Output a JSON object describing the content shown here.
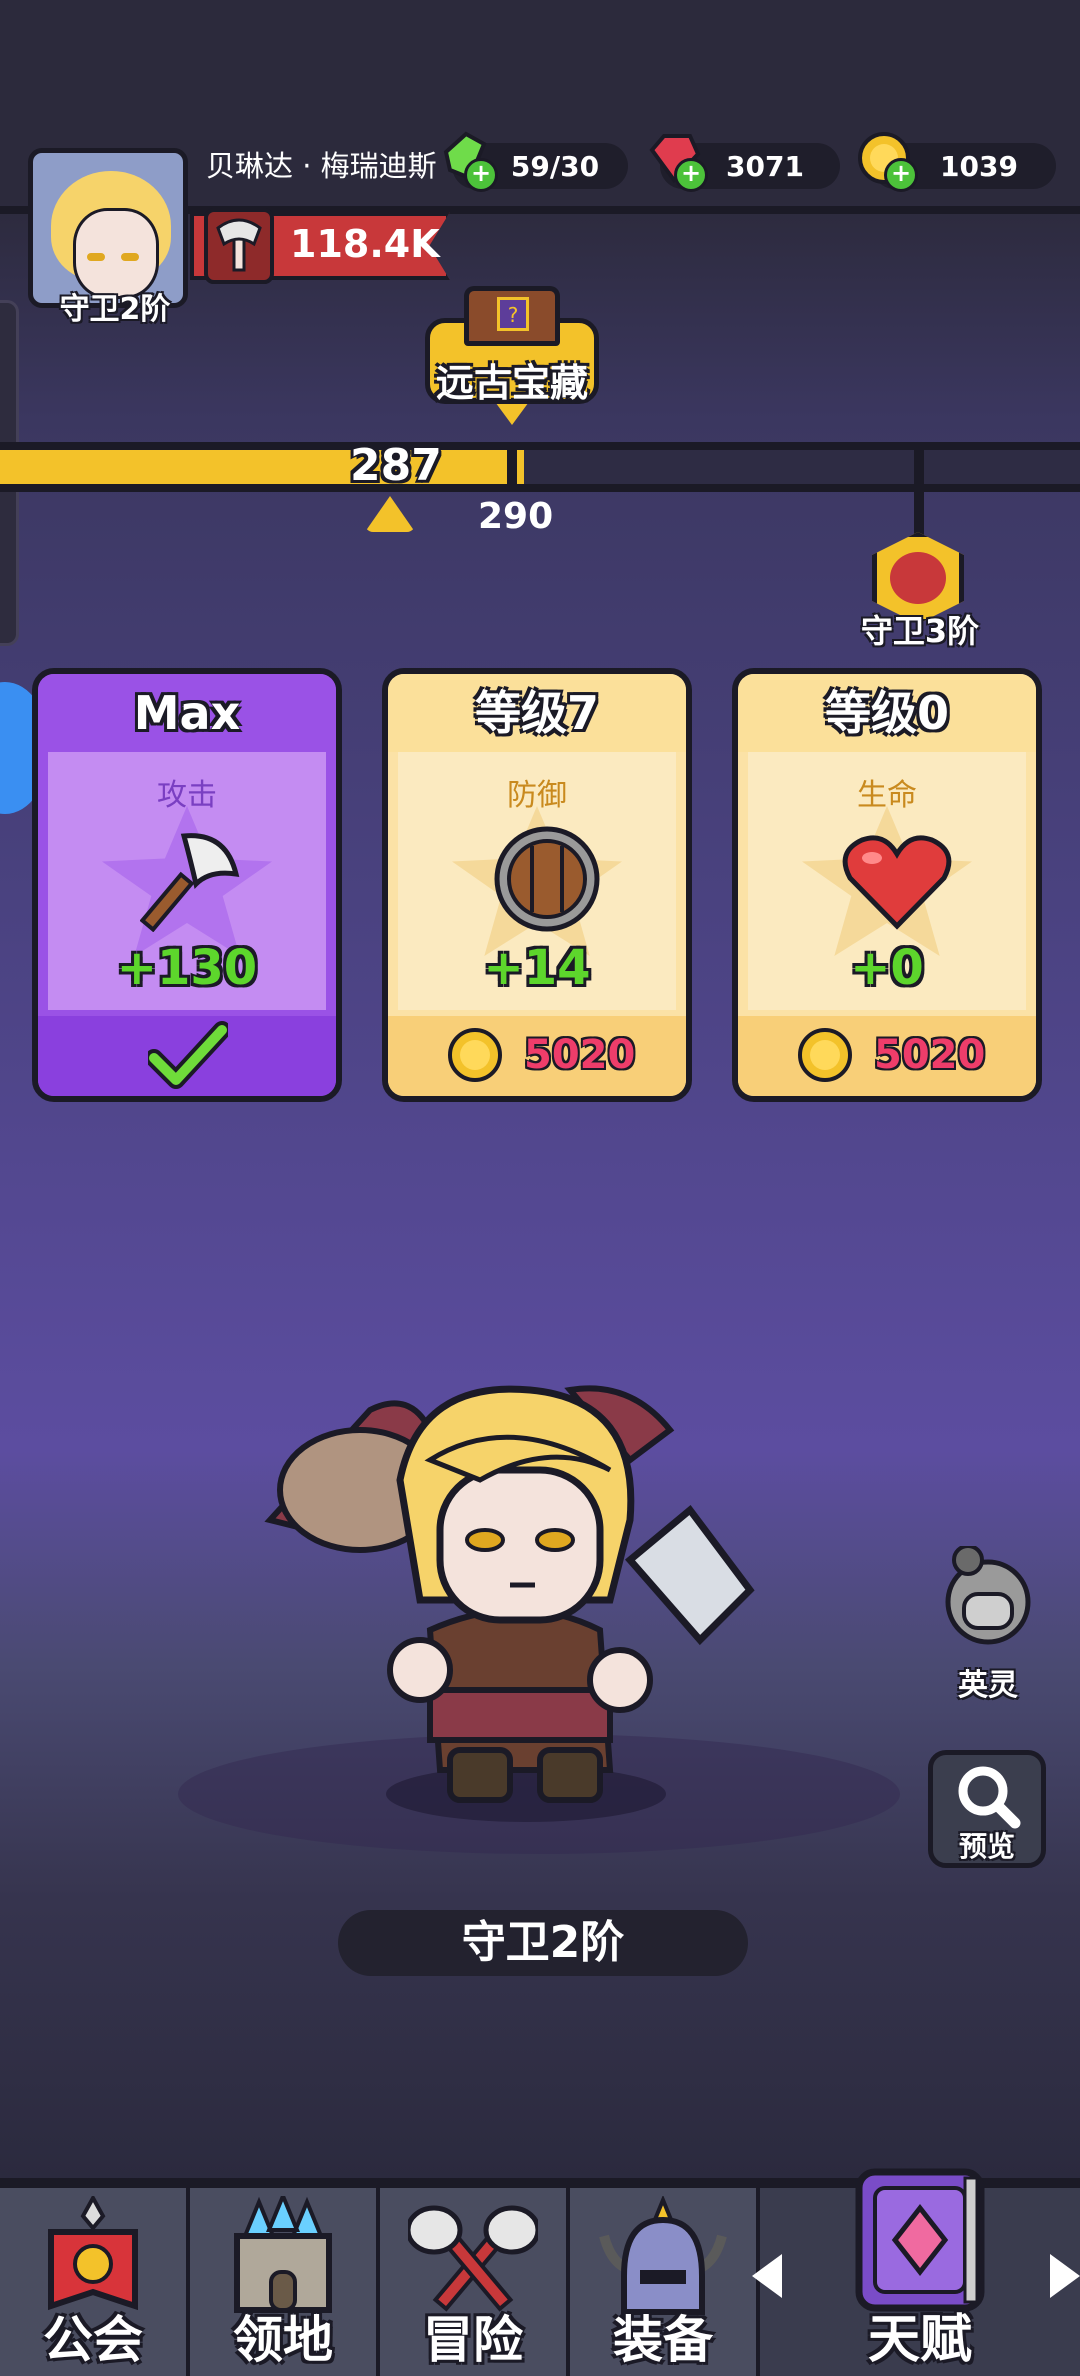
{
  "player": {
    "name": "贝琳达 · 梅瑞迪斯",
    "rank": "守卫2阶",
    "power": "118.4K"
  },
  "resources": {
    "energy": "59/30",
    "gems": "3071",
    "gold": "1039"
  },
  "event": {
    "label": "远古宝藏"
  },
  "progress": {
    "current": "287",
    "next_marker": "290",
    "next_rank": "守卫3阶",
    "fill_fraction": 0.485
  },
  "upgrade_cards": [
    {
      "header": "Max",
      "stat": "攻击",
      "bonus": "+130",
      "icon": "axe-icon",
      "status": "maxed"
    },
    {
      "header": "等级7",
      "stat": "防御",
      "bonus": "+14",
      "cost": "5020",
      "icon": "shield-icon"
    },
    {
      "header": "等级0",
      "stat": "生命",
      "bonus": "+0",
      "cost": "5020",
      "icon": "heart-icon"
    }
  ],
  "hero": {
    "rank_label": "守卫2阶"
  },
  "side_buttons": {
    "spirit": "英灵",
    "preview": "预览"
  },
  "nav": [
    {
      "label": "公会",
      "icon": "guild-banner-icon"
    },
    {
      "label": "领地",
      "icon": "castle-icon"
    },
    {
      "label": "冒险",
      "icon": "crossed-axes-icon"
    },
    {
      "label": "装备",
      "icon": "helmet-icon"
    },
    {
      "label": "天赋",
      "icon": "talent-book-icon"
    }
  ],
  "colors": {
    "gold": "#f3c22a",
    "purple_card": "#9a52e6",
    "cream_card": "#fbeac0",
    "bonus_green": "#5dd62c",
    "cost_pink": "#ee3d6a"
  }
}
